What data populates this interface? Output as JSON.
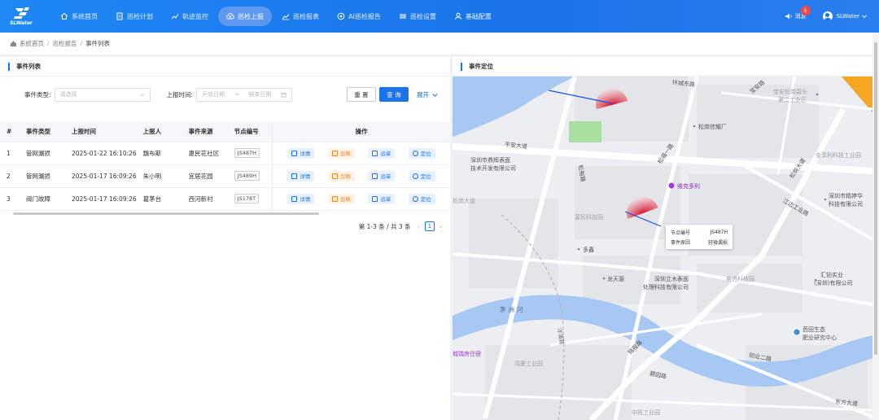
{
  "app": {
    "logo_text": "SLWater",
    "nav": [
      {
        "label": "系统首页",
        "icon": "home-icon"
      },
      {
        "label": "巡检计划",
        "icon": "document-icon"
      },
      {
        "label": "轨迹监控",
        "icon": "route-icon"
      },
      {
        "label": "巡检上报",
        "icon": "cloud-upload-icon",
        "active": true
      },
      {
        "label": "巡检报表",
        "icon": "chart-icon"
      },
      {
        "label": "AI巡检报告",
        "icon": "ai-icon"
      },
      {
        "label": "巡检设置",
        "icon": "settings-icon"
      },
      {
        "label": "基础配置",
        "icon": "person-icon"
      }
    ],
    "messages_label": "消息",
    "messages_count": "5",
    "user_name": "SLWater"
  },
  "breadcrumb": [
    "系统首页",
    "巡检报告",
    "事件列表"
  ],
  "list_panel": {
    "title": "事件列表",
    "filters": {
      "type_label": "事件类型:",
      "type_placeholder": "请选择",
      "time_label": "上报时间:",
      "start_placeholder": "开始日期",
      "range_sep": "→",
      "end_placeholder": "结束日期",
      "reset": "重 置",
      "query": "查 询",
      "expand": "展开"
    },
    "columns": [
      "#",
      "事件类型",
      "上报时间",
      "上报人",
      "事件来源",
      "节点编号",
      "操作"
    ],
    "rows": [
      {
        "idx": "1",
        "type": "管网漏损",
        "time": "2025-01-22 16:10:26",
        "reporter": "魏布斯",
        "source": "惠民花社区",
        "node": "JS487H"
      },
      {
        "idx": "2",
        "type": "管网漏损",
        "time": "2025-01-17 16:09:26",
        "reporter": "朱小明",
        "source": "宜居花园",
        "node": "JS489H"
      },
      {
        "idx": "3",
        "type": "阀门故障",
        "time": "2025-01-17 16:09:26",
        "reporter": "葛茅台",
        "source": "西河新村",
        "node": "JS178T"
      }
    ],
    "ops": {
      "detail": "详情",
      "ignore": "忽略",
      "dispatch": "派单",
      "locate": "定位"
    },
    "pagination": {
      "summary": "第 1-3 条 / 共 3 条",
      "current": "1"
    }
  },
  "map_panel": {
    "title": "事件定位",
    "labels": [
      {
        "text": "平安大道"
      },
      {
        "text": "深圳市鼎辉表面"
      },
      {
        "text": "技术开发有限公司"
      },
      {
        "text": "维克多利"
      },
      {
        "text": "富民科技园"
      },
      {
        "text": "多鑫"
      },
      {
        "text": "龙天源"
      },
      {
        "text": "深圳立木表面"
      },
      {
        "text": "处理科技有限公司"
      },
      {
        "text": "松岗信耀厂"
      },
      {
        "text": "宝安松岗碧头"
      },
      {
        "text": "第二工业区"
      },
      {
        "text": "金享利科技工业园"
      },
      {
        "text": "深圳市精婷华"
      },
      {
        "text": "科技有限公司"
      },
      {
        "text": "汇钻实业"
      },
      {
        "text": "(深圳)有限公司"
      },
      {
        "text": "茅洲河"
      },
      {
        "text": "芭田生态"
      },
      {
        "text": "肥业研究中心"
      },
      {
        "text": "创业二路"
      },
      {
        "text": "碧园路"
      },
      {
        "text": "湾厦工业园"
      },
      {
        "text": "中凯工业园"
      },
      {
        "text": "奋进科技园"
      },
      {
        "text": "江边工业路"
      },
      {
        "text": "松岗大道"
      },
      {
        "text": "环城东路"
      },
      {
        "text": "松裕路"
      },
      {
        "text": "宝安路"
      },
      {
        "text": "洋涌路"
      },
      {
        "text": "锦程路"
      },
      {
        "text": "东方大道"
      },
      {
        "text": "城瑞房住宿"
      },
      {
        "text": "松福一路"
      },
      {
        "text": "松岗大道"
      }
    ],
    "tooltip": {
      "node_label": "节点编号",
      "node_value": "JS487H",
      "reason_label": "事件原因",
      "reason_value": "轻微漏损"
    }
  }
}
